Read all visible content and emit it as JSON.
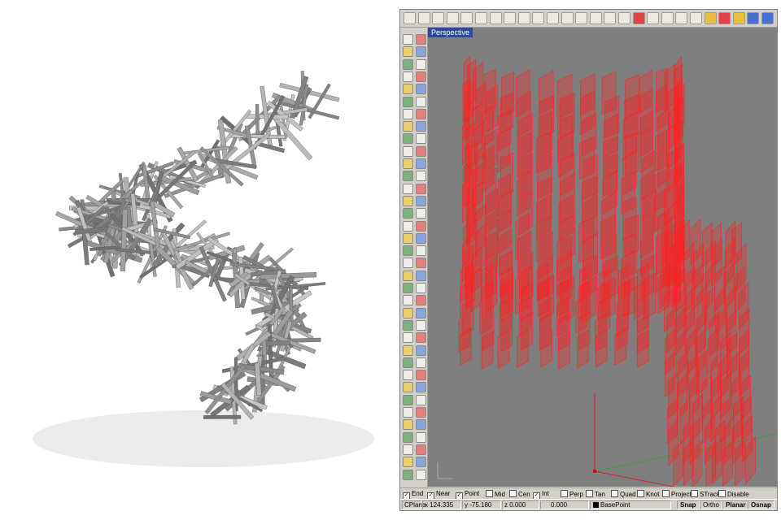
{
  "viewport": {
    "label": "Perspective",
    "background": "#7f7f7f",
    "model_color": "#ff2020"
  },
  "toolbar": {
    "icons": [
      "new-file-icon",
      "open-icon",
      "save-icon",
      "print-icon",
      "export-icon",
      "cut-icon",
      "copy-icon",
      "paste-icon",
      "undo-icon",
      "pan-icon",
      "zoom-icon",
      "zoom-window-icon",
      "zoom-extents-icon",
      "zoom-selected-icon",
      "rotate-view-icon",
      "viewport-layout-icon",
      "car-icon",
      "grid-icon",
      "snap-icon",
      "layer-icon",
      "properties-icon",
      "light-icon",
      "render-icon",
      "color-wheel-icon",
      "material-icon",
      "sphere-icon"
    ]
  },
  "osnap": {
    "items": [
      {
        "label": "End",
        "checked": true
      },
      {
        "label": "Near",
        "checked": true
      },
      {
        "label": "Point",
        "checked": true
      },
      {
        "label": "Mid",
        "checked": false
      },
      {
        "label": "Cen",
        "checked": false
      },
      {
        "label": "Int",
        "checked": true
      },
      {
        "label": "Perp",
        "checked": false
      },
      {
        "label": "Tan",
        "checked": false
      },
      {
        "label": "Quad",
        "checked": false
      },
      {
        "label": "Knot",
        "checked": false
      },
      {
        "label": "Project",
        "checked": false
      },
      {
        "label": "STrack",
        "checked": false
      },
      {
        "label": "Disable",
        "checked": false
      }
    ]
  },
  "status": {
    "cplane": "CPlane",
    "x": "x 124.335",
    "y": "y -75.180",
    "z": "z 0.000",
    "distance": "0.000",
    "layer": "BasePoint",
    "snap": "Snap",
    "ortho": "Ortho",
    "planar": "Planar",
    "osnap": "Osnap"
  }
}
